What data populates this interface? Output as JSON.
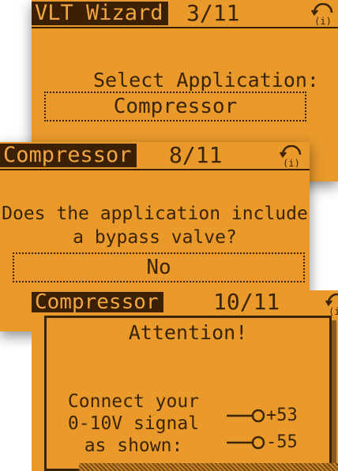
{
  "screen1": {
    "header": {
      "tag": "VLT Wizard",
      "step": "3/11"
    },
    "prompt": "Select Application:",
    "selection": "Compressor"
  },
  "screen2": {
    "header": {
      "tag": "Compressor",
      "step": "8/11"
    },
    "prompt_line1": "Does the application include",
    "prompt_line2": "a bypass valve?",
    "selection": "No"
  },
  "screen3": {
    "header": {
      "tag": "Compressor",
      "step": "10/11"
    },
    "dialog": {
      "title": "Attention!",
      "message_line1": "Connect your",
      "message_line2": "0-10V signal",
      "message_line3": "as shown:",
      "terminal_1": "+53",
      "terminal_2": "-55"
    }
  },
  "colors": {
    "lcd_background": "#e99a2b",
    "lcd_ink": "#3a2406"
  },
  "icons": [
    "info-nav-icon"
  ]
}
